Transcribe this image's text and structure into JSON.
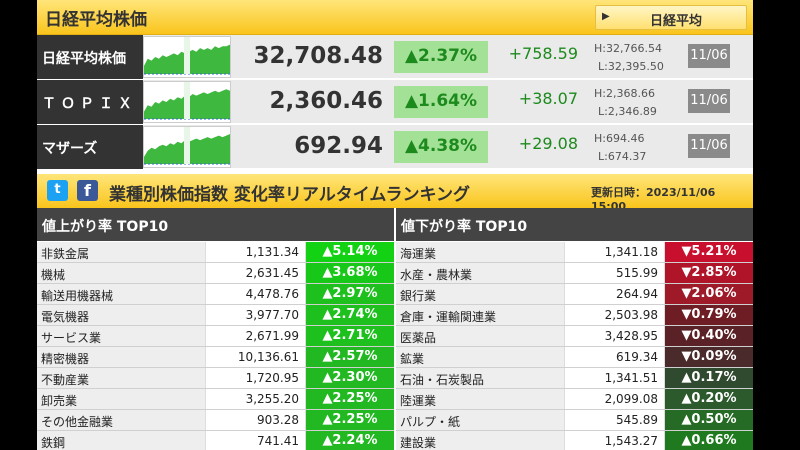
{
  "header": {
    "title": "日経平均株価",
    "button_label": "日経平均",
    "button_arrow": "▶"
  },
  "indices": [
    {
      "name": "日経平均株価",
      "price": "32,708.48",
      "change_pct": "▲2.37%",
      "change": "+758.59",
      "high": "H:32,766.54",
      "low": "L:32,395.50",
      "date": "11/06",
      "spark": [
        12,
        16,
        15,
        17,
        16,
        18,
        17,
        18,
        19,
        18,
        20,
        19,
        20,
        21,
        20,
        22,
        21,
        22,
        21,
        23,
        22,
        23,
        23,
        24
      ]
    },
    {
      "name": "ＴＯＰＩＸ",
      "price": "2,360.46",
      "change_pct": "▲1.64%",
      "change": "+38.07",
      "high": "H:2,368.66",
      "low": "L:2,346.89",
      "date": "11/06",
      "spark": [
        10,
        14,
        13,
        16,
        15,
        17,
        16,
        18,
        17,
        19,
        18,
        20,
        19,
        21,
        20,
        21,
        22,
        21,
        22,
        23,
        22,
        23,
        24,
        23
      ]
    },
    {
      "name": "マザーズ",
      "price": "692.94",
      "change_pct": "▲4.38%",
      "change": "+29.08",
      "high": "H:694.46",
      "low": "L:674.37",
      "date": "11/06",
      "spark": [
        14,
        18,
        20,
        19,
        21,
        22,
        21,
        23,
        22,
        24,
        23,
        25,
        24,
        25,
        26,
        25,
        26,
        27,
        26,
        27,
        28,
        27,
        28,
        29
      ]
    }
  ],
  "ranking": {
    "title": "業種別株価指数 変化率リアルタイムランキング",
    "updated": "更新日時：2023/11/06 15:00",
    "twitter_glyph": "t",
    "facebook_glyph": "f",
    "up_header": "値上がり率 TOP10",
    "down_header": "値下がり率 TOP10",
    "up": [
      {
        "name": "非鉄金属",
        "value": "1,131.34",
        "pct": "▲5.14%"
      },
      {
        "name": "機械",
        "value": "2,631.45",
        "pct": "▲3.68%"
      },
      {
        "name": "輸送用機器械",
        "value": "4,478.76",
        "pct": "▲2.97%"
      },
      {
        "name": "電気機器",
        "value": "3,977.70",
        "pct": "▲2.74%"
      },
      {
        "name": "サービス業",
        "value": "2,671.99",
        "pct": "▲2.71%"
      },
      {
        "name": "精密機器",
        "value": "10,136.61",
        "pct": "▲2.57%"
      },
      {
        "name": "不動産業",
        "value": "1,720.95",
        "pct": "▲2.30%"
      },
      {
        "name": "卸売業",
        "value": "3,255.20",
        "pct": "▲2.25%"
      },
      {
        "name": "その他金融業",
        "value": "903.28",
        "pct": "▲2.25%"
      },
      {
        "name": "鉄鋼",
        "value": "741.41",
        "pct": "▲2.24%"
      }
    ],
    "down": [
      {
        "name": "海運業",
        "value": "1,341.18",
        "pct": "▼5.21%",
        "color": "#c8102e"
      },
      {
        "name": "水産・農林業",
        "value": "515.99",
        "pct": "▼2.85%",
        "color": "#b01428"
      },
      {
        "name": "銀行業",
        "value": "264.94",
        "pct": "▼2.06%",
        "color": "#9e1a28"
      },
      {
        "name": "倉庫・運輸関連業",
        "value": "2,503.98",
        "pct": "▼0.79%",
        "color": "#6e1d24"
      },
      {
        "name": "医薬品",
        "value": "3,428.95",
        "pct": "▼0.40%",
        "color": "#5a2226"
      },
      {
        "name": "鉱業",
        "value": "619.34",
        "pct": "▼0.09%",
        "color": "#4a2a2a"
      },
      {
        "name": "石油・石炭製品",
        "value": "1,341.51",
        "pct": "▲0.17%",
        "color": "#2f4a2f"
      },
      {
        "name": "陸運業",
        "value": "2,099.08",
        "pct": "▲0.20%",
        "color": "#2c5a2c"
      },
      {
        "name": "パルプ・紙",
        "value": "545.89",
        "pct": "▲0.50%",
        "color": "#256a25"
      },
      {
        "name": "建設業",
        "value": "1,543.27",
        "pct": "▲0.66%",
        "color": "#1f7a1f"
      }
    ],
    "up_colors": [
      "#13d213",
      "#18c818",
      "#1ec01e",
      "#1ec01e",
      "#1ec01e",
      "#22b822",
      "#22b822",
      "#22b822",
      "#22b822",
      "#22b822"
    ]
  }
}
